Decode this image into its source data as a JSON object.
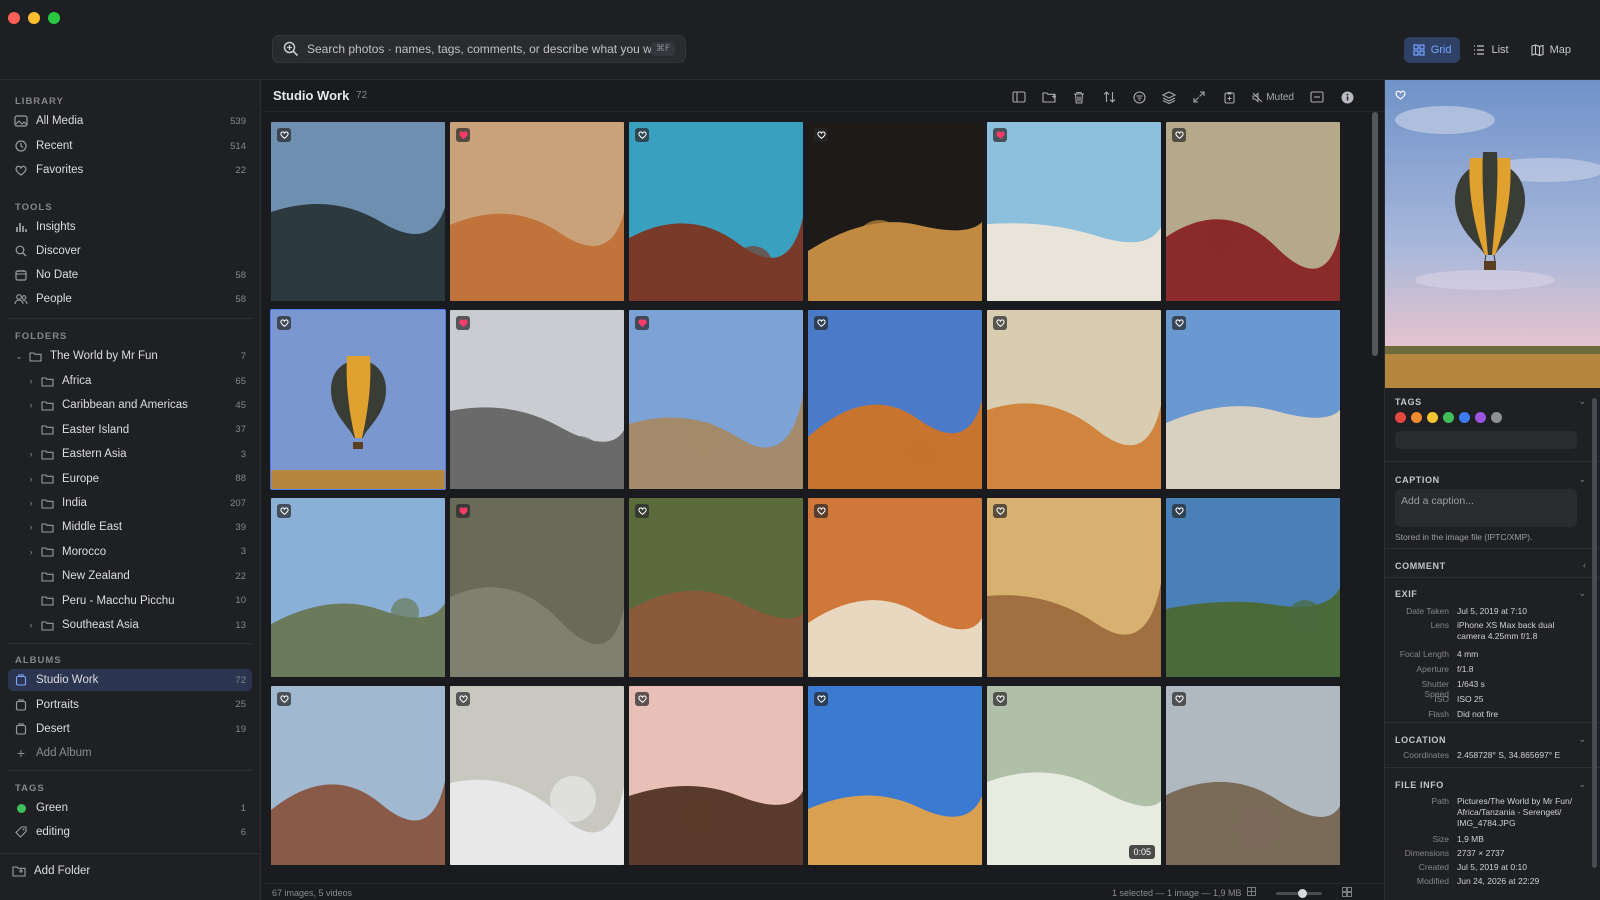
{
  "search": {
    "placeholder": "Search photos · names, tags, comments, or describe what you want",
    "shortcut": "⌘F"
  },
  "view_switch": [
    {
      "label": "Grid",
      "icon": "grid-icon",
      "active": true
    },
    {
      "label": "List",
      "icon": "list-icon",
      "active": false
    },
    {
      "label": "Map",
      "icon": "map-icon",
      "active": false
    }
  ],
  "sidebar": {
    "library_title": "LIBRARY",
    "library": [
      {
        "label": "All Media",
        "count": "539",
        "icon": "photos-icon"
      },
      {
        "label": "Recent",
        "count": "514",
        "icon": "clock-icon"
      },
      {
        "label": "Favorites",
        "count": "22",
        "icon": "heart-icon"
      }
    ],
    "tools_title": "TOOLS",
    "tools": [
      {
        "label": "Insights",
        "count": "",
        "icon": "bar-chart-icon"
      },
      {
        "label": "Discover",
        "count": "",
        "icon": "search-icon"
      },
      {
        "label": "No Date",
        "count": "58",
        "icon": "calendar-icon"
      },
      {
        "label": "People",
        "count": "58",
        "icon": "people-icon"
      }
    ],
    "folders_title": "FOLDERS",
    "root_folder": {
      "label": "The World by Mr Fun",
      "count": "7"
    },
    "folders": [
      {
        "label": "Africa",
        "count": "65",
        "expandable": true
      },
      {
        "label": "Caribbean and Americas",
        "count": "45",
        "expandable": true
      },
      {
        "label": "Easter Island",
        "count": "37",
        "expandable": false
      },
      {
        "label": "Eastern Asia",
        "count": "3",
        "expandable": true
      },
      {
        "label": "Europe",
        "count": "88",
        "expandable": true
      },
      {
        "label": "India",
        "count": "207",
        "expandable": true
      },
      {
        "label": "Middle East",
        "count": "39",
        "expandable": true
      },
      {
        "label": "Morocco",
        "count": "3",
        "expandable": true
      },
      {
        "label": "New Zealand",
        "count": "22",
        "expandable": false
      },
      {
        "label": "Peru - Macchu Picchu",
        "count": "10",
        "expandable": false
      },
      {
        "label": "Southeast Asia",
        "count": "13",
        "expandable": true
      }
    ],
    "albums_title": "ALBUMS",
    "albums": [
      {
        "label": "Studio Work",
        "count": "72",
        "active": true
      },
      {
        "label": "Portraits",
        "count": "25",
        "active": false
      },
      {
        "label": "Desert",
        "count": "19",
        "active": false
      }
    ],
    "add_album": "Add Album",
    "tags_title": "TAGS",
    "tags": [
      {
        "label": "Green",
        "count": "1",
        "color": "#3fbf5a"
      },
      {
        "label": "editing",
        "count": "6",
        "color": ""
      }
    ],
    "add_folder": "Add Folder"
  },
  "main": {
    "title": "Studio Work",
    "count": "72",
    "muted_label": "Muted",
    "footer_left": "67 images, 5 videos",
    "footer_right": "1 selected — 1 image — 1,9 MB",
    "video_duration": "0:05",
    "favorites": [
      1,
      4,
      7,
      8,
      13
    ],
    "selected_index": 6
  },
  "inspector": {
    "tags_title": "TAGS",
    "tag_colors": [
      "#e5483f",
      "#f08a2e",
      "#f2c531",
      "#3fbf5a",
      "#3c7cf0",
      "#9a55e0",
      "#8e8f94"
    ],
    "caption_title": "CAPTION",
    "caption_placeholder": "Add a caption...",
    "caption_note": "Stored in the image file (IPTC/XMP).",
    "comment_title": "COMMENT",
    "exif_title": "EXIF",
    "exif": [
      {
        "k": "Date Taken",
        "v": "Jul 5, 2019 at 7:10"
      },
      {
        "k": "Lens",
        "v": "iPhone XS Max back dual camera 4.25mm f/1.8"
      },
      {
        "k": "Focal Length",
        "v": "4 mm"
      },
      {
        "k": "Aperture",
        "v": "f/1.8"
      },
      {
        "k": "Shutter Speed",
        "v": "1/643 s"
      },
      {
        "k": "ISO",
        "v": "ISO 25"
      },
      {
        "k": "Flash",
        "v": "Did not fire"
      }
    ],
    "location_title": "LOCATION",
    "location": {
      "k": "Coordinates",
      "v": "2.458728° S, 34.865697° E"
    },
    "fileinfo_title": "FILE INFO",
    "fileinfo": [
      {
        "k": "Path",
        "v": "Pictures/The World by Mr Fun/ Africa/Tanzania - Serengeti/ IMG_4784.JPG"
      },
      {
        "k": "Size",
        "v": "1,9 MB"
      },
      {
        "k": "Dimensions",
        "v": "2737 × 2737"
      },
      {
        "k": "Created",
        "v": "Jul 5, 2019 at 0:10"
      },
      {
        "k": "Modified",
        "v": "Jun 24, 2026 at 22:29"
      }
    ]
  }
}
